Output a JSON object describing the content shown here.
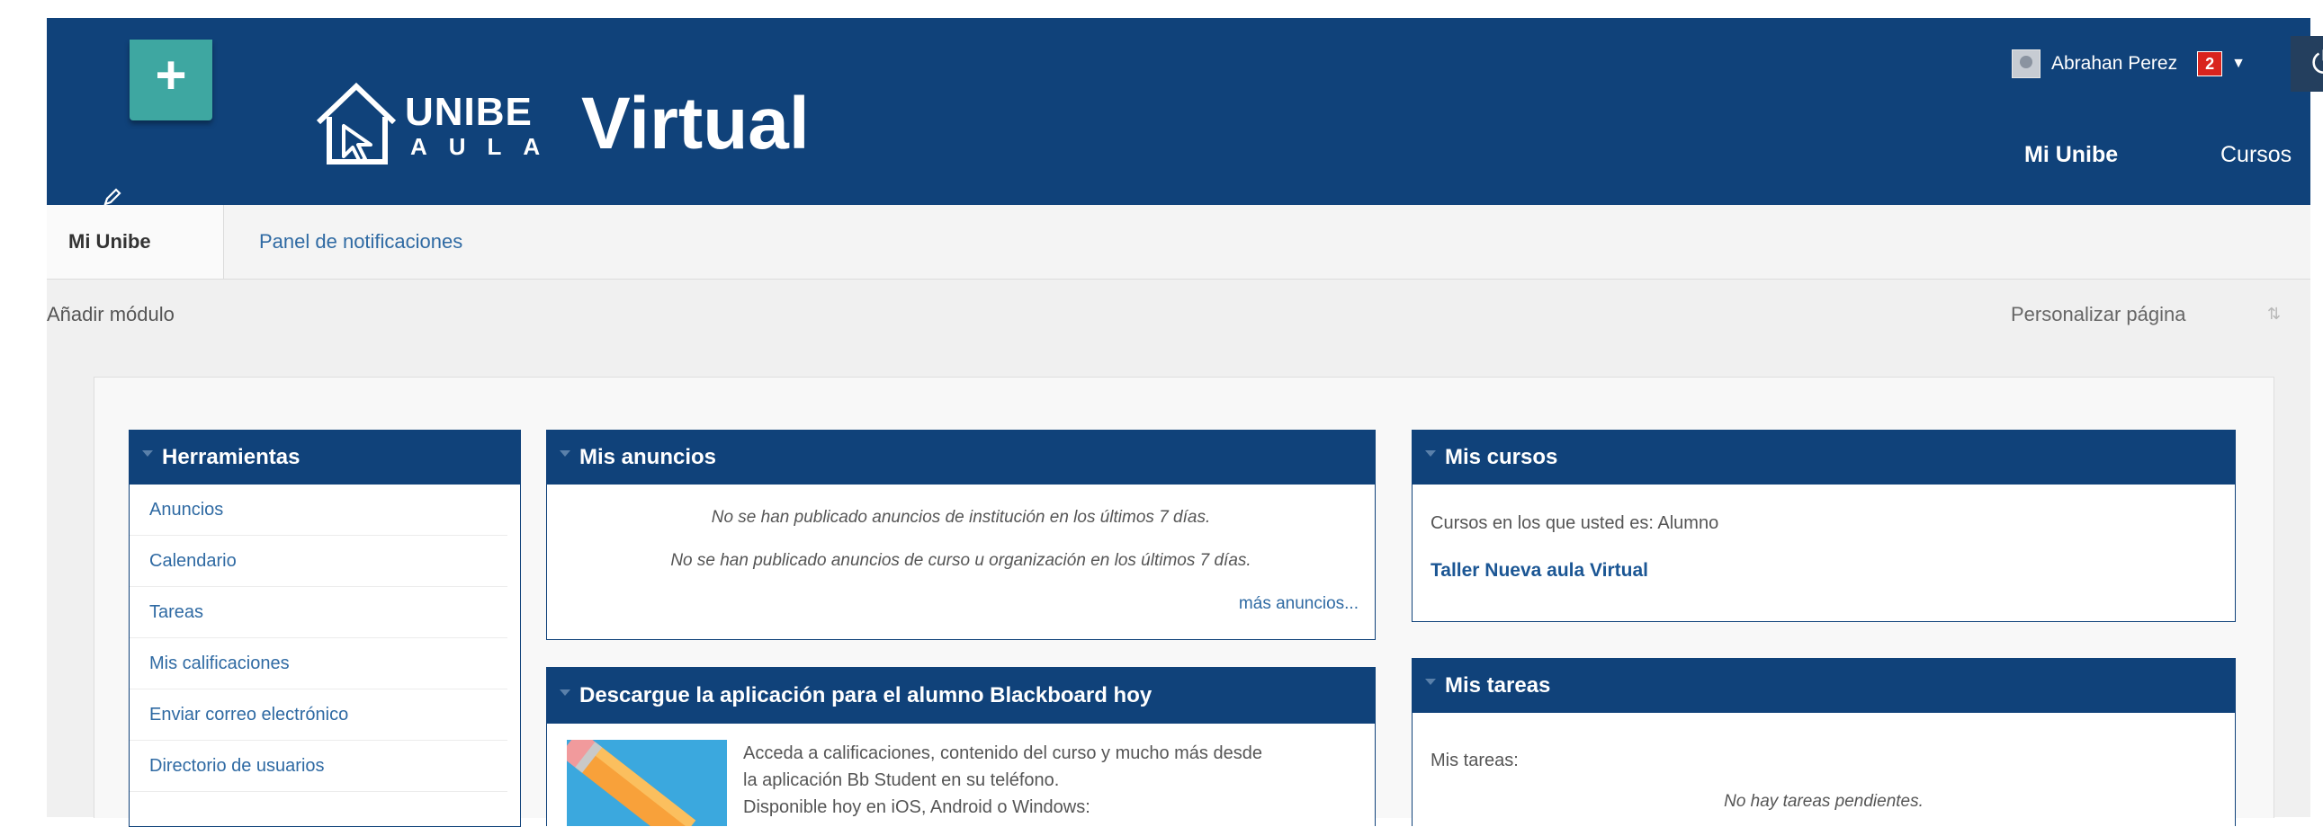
{
  "header": {
    "logo_unibe": "UNIBE",
    "logo_aula": "AULA",
    "logo_virtual": "Virtual",
    "add_tab_symbol": "+",
    "user_name": "Abrahan Perez",
    "notification_count": "2",
    "caret_symbol": "▼",
    "power_symbol": "⏻",
    "nav": {
      "mi_unibe": "Mi Unibe",
      "cursos": "Cursos"
    }
  },
  "tabs": {
    "active": "Mi Unibe",
    "notifications": "Panel de notificaciones"
  },
  "toolbar": {
    "add_module": "Añadir módulo",
    "customize": "Personalizar página",
    "sort_symbol": "⇅"
  },
  "modules": {
    "herramientas": {
      "title": "Herramientas",
      "items": [
        "Anuncios",
        "Calendario",
        "Tareas",
        "Mis calificaciones",
        "Enviar correo electrónico",
        "Directorio de usuarios"
      ]
    },
    "anuncios": {
      "title": "Mis anuncios",
      "line1": "No se han publicado anuncios de institución en los últimos 7 días.",
      "line2": "No se han publicado anuncios de curso u organización en los últimos 7 días.",
      "more": "más anuncios..."
    },
    "app": {
      "title": "Descargue la aplicación para el alumno Blackboard hoy",
      "line1": "Acceda a calificaciones, contenido del curso y mucho más desde",
      "line2": "la aplicación Bb Student en su teléfono.",
      "line3": "Disponible hoy en iOS, Android o Windows:"
    },
    "cursos": {
      "title": "Mis cursos",
      "role_text": "Cursos en los que usted es: Alumno",
      "course": "Taller Nueva aula Virtual"
    },
    "tareas": {
      "title": "Mis tareas",
      "label": "Mis tareas:",
      "empty": "No hay tareas pendientes."
    }
  },
  "colors": {
    "header_bg": "#10427a",
    "accent_teal": "#3ea7a1",
    "link": "#2f6aa3",
    "badge_red": "#d9241e"
  },
  "icons": [
    "plus-icon",
    "house-cursor-logo-icon",
    "pencil-icon",
    "user-avatar-icon",
    "power-icon",
    "sort-icon",
    "collapse-triangle-icon",
    "pencil-app-icon"
  ]
}
